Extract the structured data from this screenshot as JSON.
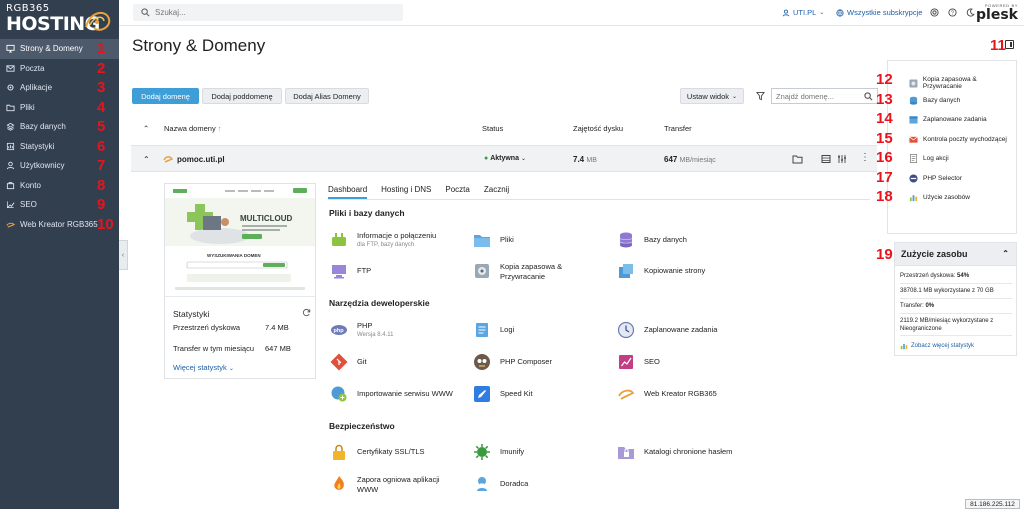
{
  "brand": {
    "line1": "RGB365",
    "line2": "HOSTING"
  },
  "sidebar": {
    "items": [
      {
        "label": "Strony & Domeny",
        "num": "1",
        "icon": "monitor-icon",
        "active": true
      },
      {
        "label": "Poczta",
        "num": "2",
        "icon": "mail-icon"
      },
      {
        "label": "Aplikacje",
        "num": "3",
        "icon": "gear-icon"
      },
      {
        "label": "Pliki",
        "num": "4",
        "icon": "folder-icon"
      },
      {
        "label": "Bazy danych",
        "num": "5",
        "icon": "database-icon"
      },
      {
        "label": "Statystyki",
        "num": "6",
        "icon": "chart-icon"
      },
      {
        "label": "Użytkownicy",
        "num": "7",
        "icon": "user-icon"
      },
      {
        "label": "Konto",
        "num": "8",
        "icon": "account-icon"
      },
      {
        "label": "SEO",
        "num": "9",
        "icon": "seo-icon"
      },
      {
        "label": "Web Kreator RGB365",
        "num": "10",
        "icon": "web-kreator-icon"
      }
    ]
  },
  "topbar": {
    "search_placeholder": "Szukaj...",
    "account": "UTI.PL",
    "subscriptions": "Wszystkie subskrypcje",
    "powered_by": "POWERED BY",
    "plesk": "plesk"
  },
  "page": {
    "title": "Strony & Domeny",
    "toggle_num": "11"
  },
  "actions": {
    "add_domain": "Dodaj domenę",
    "add_subdomain": "Dodaj poddomenę",
    "add_alias": "Dodaj Alias Domeny",
    "view": "Ustaw widok",
    "find_placeholder": "Znajdź domenę..."
  },
  "table": {
    "headers": {
      "name": "Nazwa domeny",
      "status": "Status",
      "disk": "Zajętość dysku",
      "transfer": "Transfer"
    },
    "row": {
      "domain": "pomoc.uti.pl",
      "status": "Aktywna",
      "disk_value": "7.4",
      "disk_unit": "MB",
      "transfer_value": "647",
      "transfer_unit": "MB/miesiąc"
    }
  },
  "preview": {
    "brand": "MULTICLOUD",
    "cta": "WYSZUKIWANIA DOMEN",
    "stats_title": "Statystyki",
    "disk_label": "Przestrzeń dyskowa",
    "disk_value": "7.4 MB",
    "transfer_label": "Transfer w tym miesiącu",
    "transfer_value": "647 MB",
    "more": "Więcej statystyk"
  },
  "tabs": [
    "Dashboard",
    "Hosting i DNS",
    "Poczta",
    "Zacznij"
  ],
  "sections": {
    "files": "Pliki i bazy danych",
    "dev": "Narzędzia deweloperskie",
    "security": "Bezpieczeństwo"
  },
  "tools": {
    "connection": {
      "label": "Informacje o połączeniu",
      "sub": "dla FTP, bazy danych"
    },
    "files": "Pliki",
    "databases": "Bazy danych",
    "ftp": "FTP",
    "backup_l1": "Kopia zapasowa &",
    "backup_l2": "Przywracanie",
    "copy_site": "Kopiowanie strony",
    "php": {
      "label": "PHP",
      "sub": "Wersja 8.4.11"
    },
    "logs": "Logi",
    "scheduled": "Zaplanowane zadania",
    "git": "Git",
    "composer": "PHP Composer",
    "seo": "SEO",
    "import": "Importowanie serwisu WWW",
    "speedkit": "Speed Kit",
    "webkreator": "Web Kreator RGB365",
    "ssl": "Certyfikaty SSL/TLS",
    "imunify": "Imunify",
    "protected": "Katalogi chronione hasłem",
    "firewall_l1": "Zapora ogniowa aplikacji",
    "firewall_l2": "WWW",
    "advisor": "Doradca"
  },
  "right_panel": {
    "items": [
      {
        "num": "12",
        "label": "Kopia zapasowa & Przywracanie"
      },
      {
        "num": "13",
        "label": "Bazy danych"
      },
      {
        "num": "14",
        "label": "Zaplanowane zadania"
      },
      {
        "num": "15",
        "label": "Kontrola poczty wychodzącej"
      },
      {
        "num": "16",
        "label": "Log akcji"
      },
      {
        "num": "17",
        "label": "PHP Selector"
      },
      {
        "num": "18",
        "label": "Użycie zasobów"
      }
    ]
  },
  "usage": {
    "num": "19",
    "title": "Zużycie zasobu",
    "disk_label": "Przestrzeń dyskowa:",
    "disk_pct": "54%",
    "disk_detail": "38708.1 MB wykorzystane z 70 GB",
    "transfer_label": "Transfer:",
    "transfer_pct": "0%",
    "transfer_detail": "2119.2 MB/miesiąc wykorzystane z Nieograniczone",
    "more": "Zobacz więcej statystyk"
  },
  "ip": "81.186.225.112",
  "colors": {
    "sidebar": "#323f4f",
    "accent": "#3e9ed8",
    "marker": "#e8141c",
    "active_status": "#3aa142"
  }
}
